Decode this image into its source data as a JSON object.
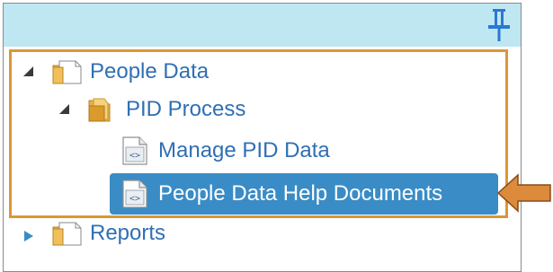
{
  "tree": {
    "items": [
      {
        "label": "People Data",
        "expanded": true,
        "icon": "folder-document-icon"
      },
      {
        "label": "PID Process",
        "expanded": true,
        "icon": "folder-icon"
      },
      {
        "label": "Manage PID Data",
        "icon": "code-document-icon"
      },
      {
        "label": "People Data Help Documents",
        "icon": "code-document-icon",
        "selected": true
      },
      {
        "label": "Reports",
        "expanded": false,
        "icon": "folder-document-icon"
      }
    ]
  },
  "colors": {
    "header": "#bfe7f1",
    "link": "#2f6fb4",
    "selection": "#3a8cc6",
    "highlight": "#dc9636",
    "pin": "#2a78d6"
  }
}
